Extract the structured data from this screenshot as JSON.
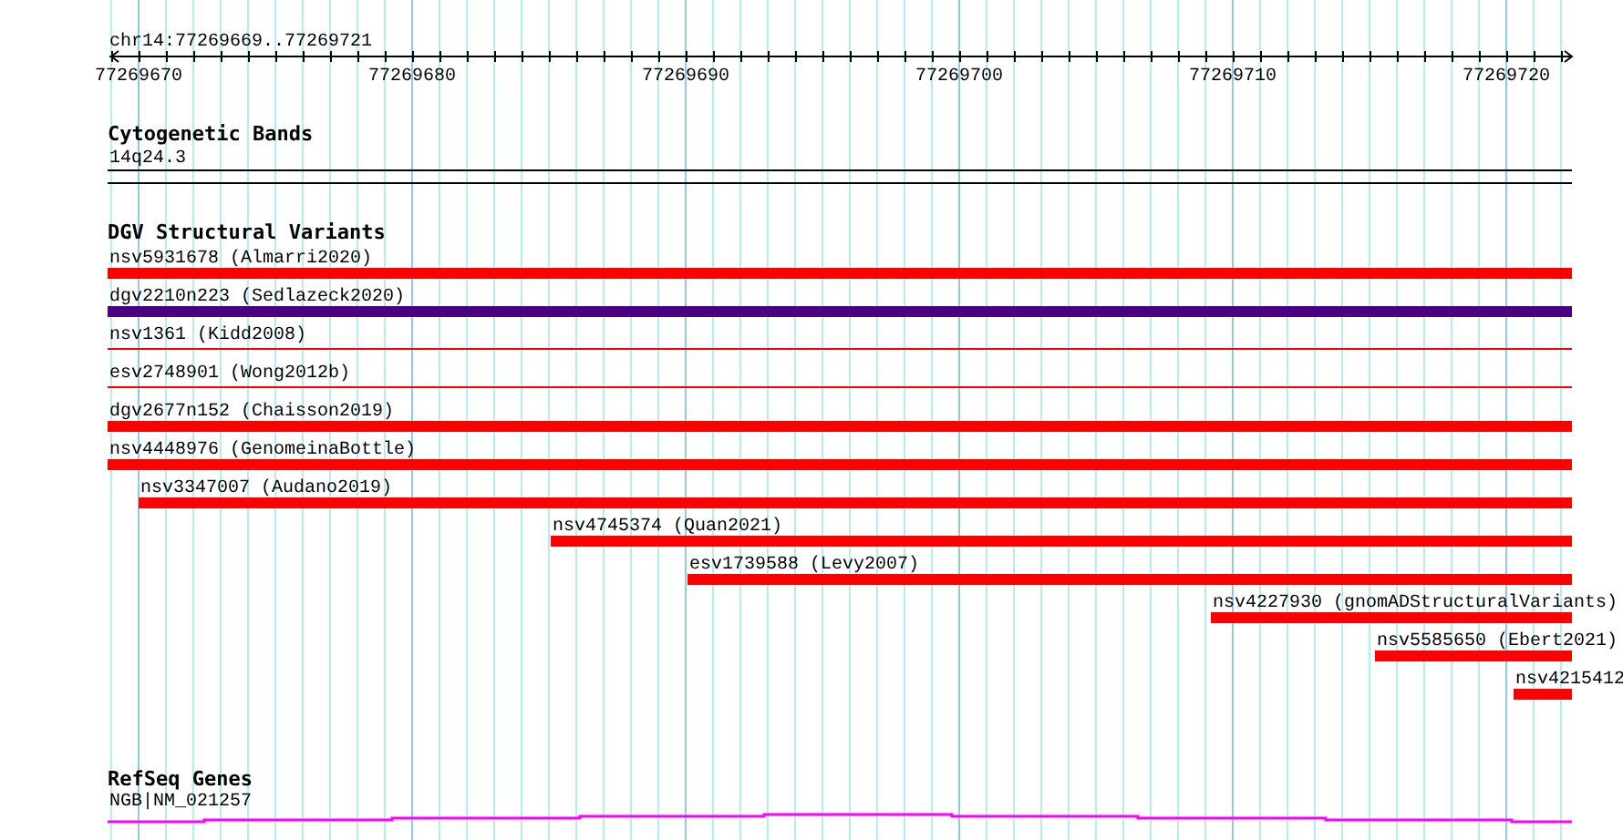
{
  "locus": "chr14:77269669..77269721",
  "ruler": {
    "ticks": [
      "77269670",
      "77269680",
      "77269690",
      "77269700",
      "77269710",
      "77269720"
    ]
  },
  "tracks": [
    {
      "kind": "cytoband",
      "title": "Cytogenetic Bands",
      "features": [
        {
          "label": "14q24.3"
        }
      ]
    },
    {
      "kind": "variants",
      "title": "DGV Structural Variants",
      "features": [
        {
          "label": "nsv5931678 (Almarri2020)",
          "kind": "bar",
          "color": "#ff0000"
        },
        {
          "label": "dgv2210n223 (Sedlazeck2020)",
          "kind": "bar",
          "color": "#4b0082"
        },
        {
          "label": "nsv1361 (Kidd2008)",
          "kind": "line",
          "color": "#ff0000"
        },
        {
          "label": "esv2748901 (Wong2012b)",
          "kind": "line",
          "color": "#ff0000"
        },
        {
          "label": "dgv2677n152 (Chaisson2019)",
          "kind": "bar",
          "color": "#ff0000"
        },
        {
          "label": "nsv4448976 (GenomeinaBottle)",
          "kind": "bar",
          "color": "#ff0000"
        },
        {
          "label": "nsv3347007 (Audano2019)",
          "kind": "bar",
          "color": "#ff0000"
        },
        {
          "label": "nsv4745374 (Quan2021)",
          "kind": "bar",
          "color": "#ff0000"
        },
        {
          "label": "esv1739588 (Levy2007)",
          "kind": "bar",
          "color": "#ff0000"
        },
        {
          "label": "nsv4227930 (gnomADStructuralVariants)",
          "kind": "bar",
          "color": "#ff0000"
        },
        {
          "label": "nsv5585650 (Ebert2021)",
          "kind": "bar",
          "color": "#ff0000"
        },
        {
          "label": "nsv4215412",
          "kind": "bar",
          "color": "#ff0000"
        }
      ]
    },
    {
      "kind": "gene",
      "title": "RefSeq Genes",
      "features": [
        {
          "label": "NGB|NM_021257"
        }
      ]
    }
  ]
}
